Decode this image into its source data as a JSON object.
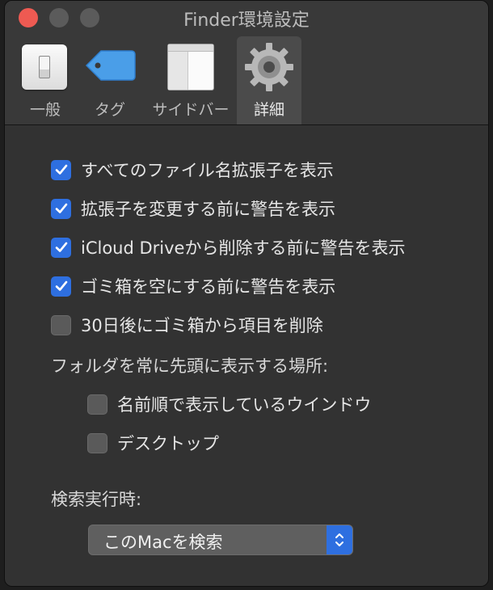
{
  "window": {
    "title": "Finder環境設定"
  },
  "toolbar": {
    "tabs": [
      {
        "label": "一般",
        "icon": "switch-icon"
      },
      {
        "label": "タグ",
        "icon": "tag-icon"
      },
      {
        "label": "サイドバー",
        "icon": "sidebar-icon"
      },
      {
        "label": "詳細",
        "icon": "gear-icon"
      }
    ],
    "active_tab": "詳細"
  },
  "advanced": {
    "options": [
      {
        "label": "すべてのファイル名拡張子を表示",
        "checked": true
      },
      {
        "label": "拡張子を変更する前に警告を表示",
        "checked": true
      },
      {
        "label": "iCloud Driveから削除する前に警告を表示",
        "checked": true
      },
      {
        "label": "ゴミ箱を空にする前に警告を表示",
        "checked": true
      },
      {
        "label": "30日後にゴミ箱から項目を削除",
        "checked": false
      }
    ],
    "folders_on_top_label": "フォルダを常に先頭に表示する場所:",
    "folders_on_top": [
      {
        "label": "名前順で表示しているウインドウ",
        "checked": false
      },
      {
        "label": "デスクトップ",
        "checked": false
      }
    ],
    "search_label": "検索実行時:",
    "search_scope": {
      "selected": "このMacを検索"
    }
  },
  "colors": {
    "accent": "#2e6fe0",
    "close": "#ee5a52",
    "window_bg": "#323232"
  }
}
